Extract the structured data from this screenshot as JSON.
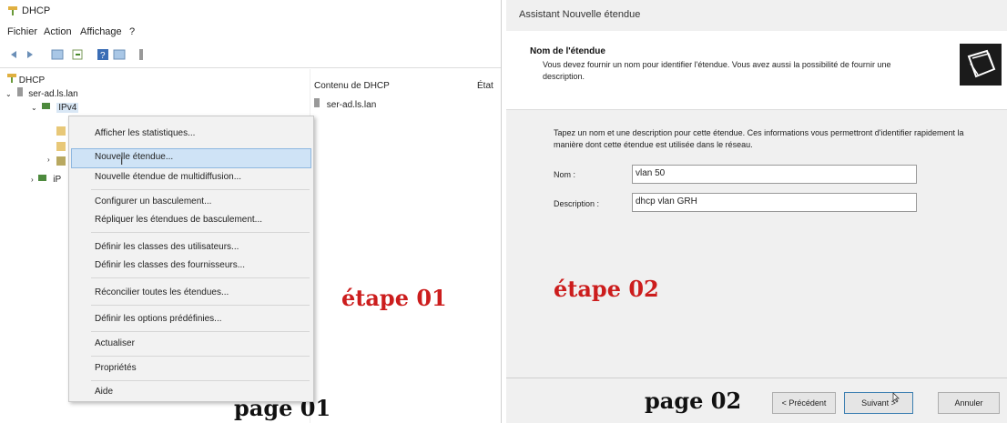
{
  "left": {
    "window_title": "DHCP",
    "menu": [
      "Fichier",
      "Action",
      "Affichage",
      "?"
    ],
    "tree": {
      "root": "DHCP",
      "server": "ser-ad.ls.lan",
      "ipv4": "IPv4",
      "ipv6_partial": "iP"
    },
    "content": {
      "col_name": "Contenu de DHCP",
      "col_state": "État",
      "row": "ser-ad.ls.lan"
    },
    "context_menu": [
      "Afficher les statistiques...",
      "Nouvelle étendue...",
      "Nouvelle étendue de multidiffusion...",
      "Configurer un basculement...",
      "Répliquer les étendues de basculement...",
      "Définir les classes des utilisateurs...",
      "Définir les classes des fournisseurs...",
      "Réconcilier toutes les étendues...",
      "Définir les options prédéfinies...",
      "Actualiser",
      "Propriétés",
      "Aide"
    ],
    "step_label": "étape 01",
    "page_label": "page 01"
  },
  "right": {
    "wizard_title": "Assistant Nouvelle étendue",
    "section_title": "Nom de l'étendue",
    "section_desc": "Vous devez fournir un nom pour identifier l'étendue. Vous avez aussi la possibilité de fournir une description.",
    "instruction": "Tapez un nom et une description pour cette étendue. Ces informations vous permettront d'identifier rapidement la manière dont cette étendue est utilisée dans le réseau.",
    "name_label": "Nom :",
    "name_value": "vlan 50",
    "desc_label": "Description :",
    "desc_value": "dhcp vlan GRH",
    "step_label": "étape 02",
    "page_label": "page 02",
    "buttons": {
      "previous": "< Précédent",
      "next": "Suivant >",
      "cancel": "Annuler"
    }
  },
  "colors": {
    "step_red": "#cc1d1d",
    "highlight": "#cfe3f6"
  }
}
